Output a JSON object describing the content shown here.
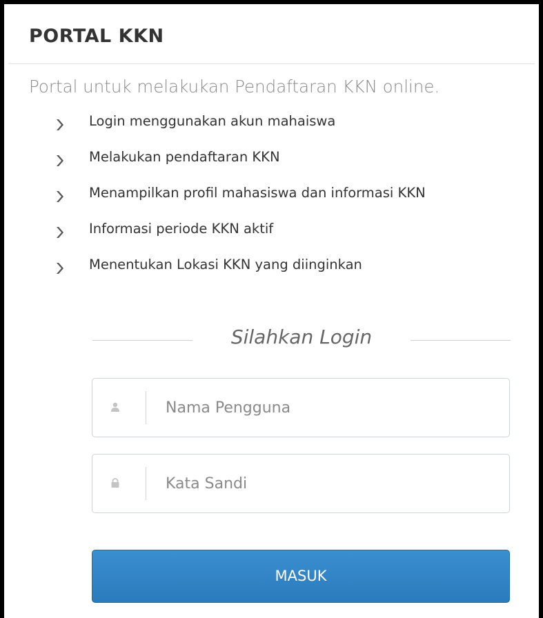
{
  "portal": {
    "title": "PORTAL KKN",
    "subtitle": "Portal untuk melakukan Pendaftaran KKN online.",
    "features": [
      {
        "label": "Login menggunakan akun mahaiswa",
        "icon": "chevron-right-icon"
      },
      {
        "label": "Melakukan pendaftaran KKN",
        "icon": "chevron-right-icon"
      },
      {
        "label": "Menampilkan profil mahasiswa dan informasi KKN",
        "icon": "chevron-right-icon"
      },
      {
        "label": "Informasi periode KKN aktif",
        "icon": "chevron-right-icon"
      },
      {
        "label": "Menentukan Lokasi KKN yang diinginkan",
        "icon": "chevron-right-icon"
      }
    ]
  },
  "login": {
    "heading": "Silahkan Login",
    "username": {
      "placeholder": "Nama Pengguna",
      "value": "",
      "icon": "user-icon"
    },
    "password": {
      "placeholder": "Kata Sandi",
      "value": "",
      "icon": "lock-icon"
    },
    "submit_label": "MASUK"
  },
  "colors": {
    "button": "#2a7bbb",
    "title_text": "#333333",
    "subtitle_text": "#8a8a8a",
    "chevron": "#555555"
  }
}
